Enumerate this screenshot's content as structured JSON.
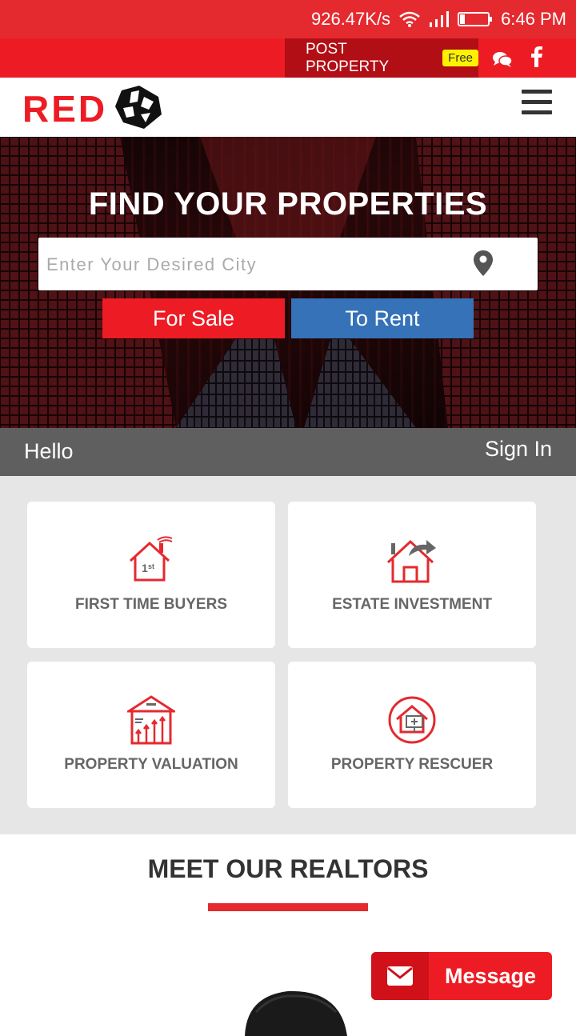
{
  "status_bar": {
    "speed": "926.47K/s",
    "time": "6:46 PM"
  },
  "topbar": {
    "post_property": "POST PROPERTY",
    "free_badge": "Free"
  },
  "header": {
    "logo_text": "RED"
  },
  "hero": {
    "title": "FIND YOUR PROPERTIES",
    "search_placeholder": "Enter Your Desired City",
    "for_sale": "For Sale",
    "to_rent": "To Rent"
  },
  "hello_bar": {
    "greeting": "Hello",
    "sign_in": "Sign In"
  },
  "cards": [
    {
      "label": "FIRST TIME BUYERS",
      "icon": "first-home-icon"
    },
    {
      "label": "ESTATE INVESTMENT",
      "icon": "house-arrow-icon"
    },
    {
      "label": "PROPERTY VALUATION",
      "icon": "valuation-icon"
    },
    {
      "label": "PROPERTY RESCUER",
      "icon": "rescue-icon"
    }
  ],
  "realtors": {
    "title": "MEET OUR REALTORS"
  },
  "message_button": {
    "label": "Message"
  },
  "colors": {
    "brand_red": "#ed1c24",
    "dark_red": "#b20e15",
    "rent_blue": "#3572b8",
    "hello_gray": "#5f5f5f"
  }
}
